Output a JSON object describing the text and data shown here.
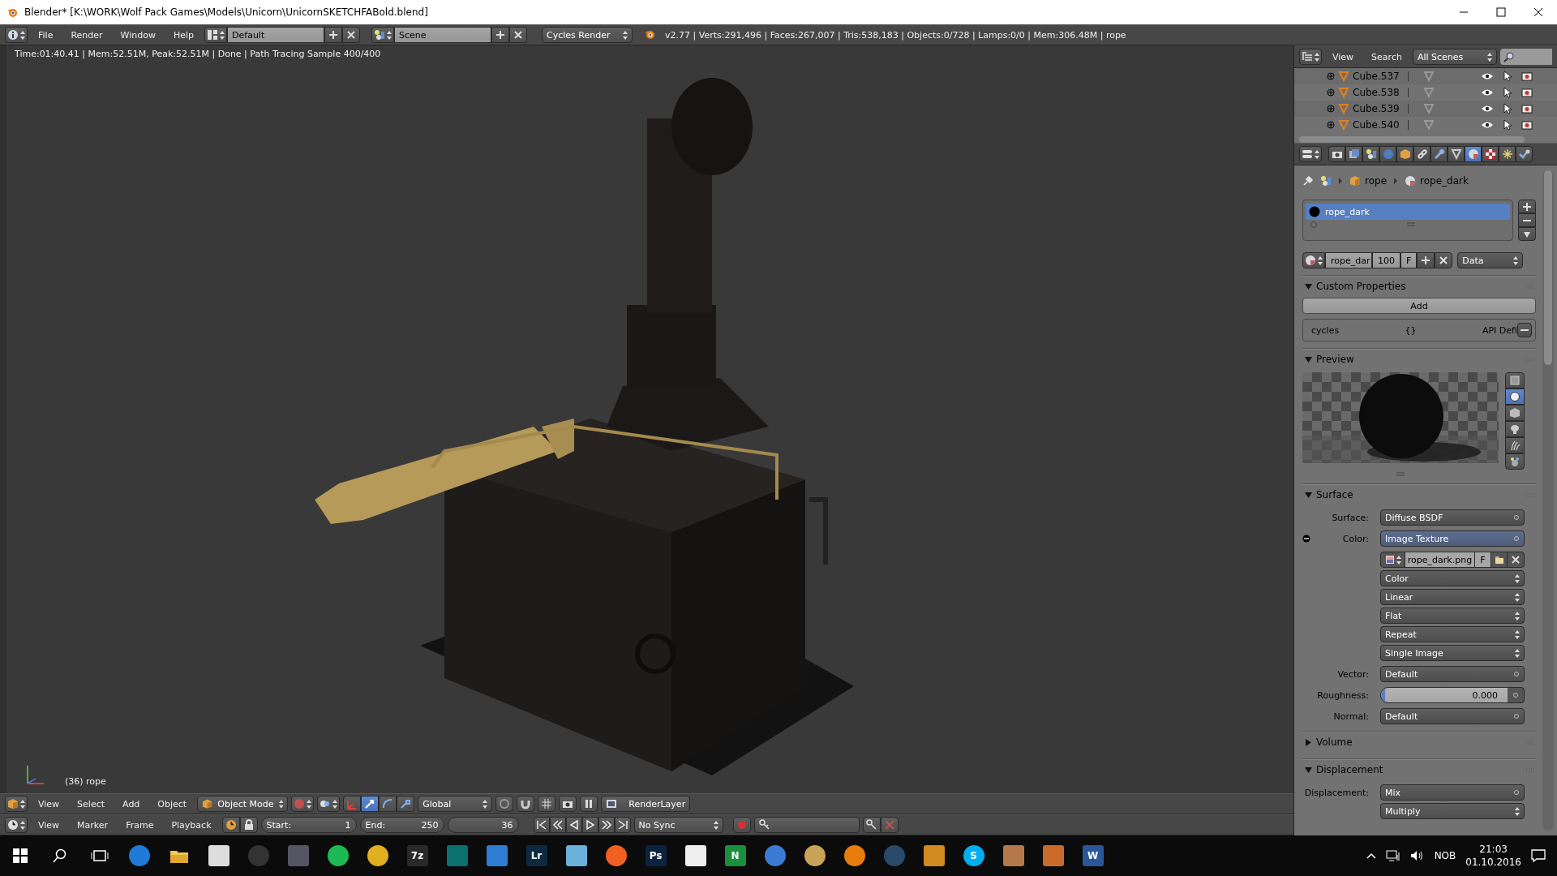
{
  "window": {
    "title": "Blender* [K:\\WORK\\Wolf Pack Games\\Models\\Unicorn\\UnicornSKETCHFABold.blend]"
  },
  "info_header": {
    "menus": [
      "File",
      "Render",
      "Window",
      "Help"
    ],
    "screen_layout": "Default",
    "scene": "Scene",
    "render_engine": "Cycles Render",
    "stats": "v2.77 | Verts:291,496 | Faces:267,007 | Tris:538,183 | Objects:0/728 | Lamps:0/0 | Mem:306.48M | rope"
  },
  "viewport": {
    "render_status": "Time:01:40.41 | Mem:52.51M, Peak:52.51M | Done | Path Tracing Sample 400/400",
    "object_label": "(36) rope"
  },
  "view3d_header": {
    "menus": [
      "View",
      "Select",
      "Add",
      "Object"
    ],
    "mode": "Object Mode",
    "manipulators": [
      {
        "selected": false
      },
      {
        "selected": true
      },
      {
        "selected": false
      },
      {
        "selected": false
      }
    ],
    "orientation": "Global",
    "render_layer": "RenderLayer"
  },
  "timeline_header": {
    "menus": [
      "View",
      "Marker",
      "Frame",
      "Playback"
    ],
    "start_label": "Start:",
    "start": "1",
    "end_label": "End:",
    "end": "250",
    "current": "36",
    "sync": "No Sync"
  },
  "outliner": {
    "menus": [
      "View",
      "Search"
    ],
    "filter": "All Scenes",
    "items": [
      {
        "name": "Cube.537"
      },
      {
        "name": "Cube.538"
      },
      {
        "name": "Cube.539"
      },
      {
        "name": "Cube.540"
      }
    ]
  },
  "properties": {
    "tabs": [
      {
        "selected": false
      },
      {
        "selected": false
      },
      {
        "selected": false
      },
      {
        "selected": false
      },
      {
        "selected": false
      },
      {
        "selected": false
      },
      {
        "selected": false
      },
      {
        "selected": false
      },
      {
        "selected": true
      },
      {
        "selected": false
      },
      {
        "selected": false
      },
      {
        "selected": false
      }
    ],
    "breadcrumb": [
      "rope",
      "rope_dark"
    ],
    "slots": [
      {
        "name": "rope_dark",
        "selected": true
      }
    ],
    "datablock": {
      "name": "rope_dar",
      "users": "100",
      "fake_user": "F",
      "link": "Data"
    },
    "panels": [
      {
        "kind": "custom_properties",
        "title": "Custom Properties",
        "expanded": true,
        "add_button": "Add",
        "properties": [
          {
            "name": "cycles",
            "value": "{}",
            "note": "API Defi"
          }
        ]
      },
      {
        "kind": "preview",
        "title": "Preview",
        "expanded": true,
        "shapes": [
          {
            "selected": false
          },
          {
            "selected": true
          },
          {
            "selected": false
          },
          {
            "selected": false
          },
          {
            "selected": false
          },
          {
            "selected": false
          }
        ]
      },
      {
        "kind": "nodes",
        "title": "Surface",
        "expanded": true,
        "rows": [
          {
            "kind": "socket",
            "label": "Surface:",
            "value": "Diffuse BSDF"
          },
          {
            "kind": "linked_socket",
            "label": "Color:",
            "value": "Image Texture"
          },
          {
            "kind": "image",
            "name": "rope_dark.png",
            "fake_user": "F"
          },
          {
            "kind": "enum",
            "value": "Color"
          },
          {
            "kind": "enum",
            "value": "Linear"
          },
          {
            "kind": "enum",
            "value": "Flat"
          },
          {
            "kind": "enum",
            "value": "Repeat"
          },
          {
            "kind": "enum",
            "value": "Single Image"
          },
          {
            "kind": "socket",
            "label": "Vector:",
            "value": "Default"
          },
          {
            "kind": "slider",
            "label": "Roughness:",
            "reading": "0.000",
            "level": 0
          },
          {
            "kind": "socket",
            "label": "Normal:",
            "value": "Default"
          }
        ]
      },
      {
        "kind": "nodes",
        "title": "Volume",
        "expanded": false
      },
      {
        "kind": "nodes",
        "title": "Displacement",
        "expanded": true,
        "rows": [
          {
            "kind": "socket",
            "label": "Displacement:",
            "value": "Mix"
          },
          {
            "kind": "enum",
            "value": "Multiply"
          }
        ]
      }
    ]
  },
  "taskbar": {
    "app_labels": [
      "7z",
      "Lr",
      "Ps",
      "N",
      "S",
      "W"
    ],
    "language": "NOB",
    "time": "21:03",
    "date": "01.10.2016"
  }
}
